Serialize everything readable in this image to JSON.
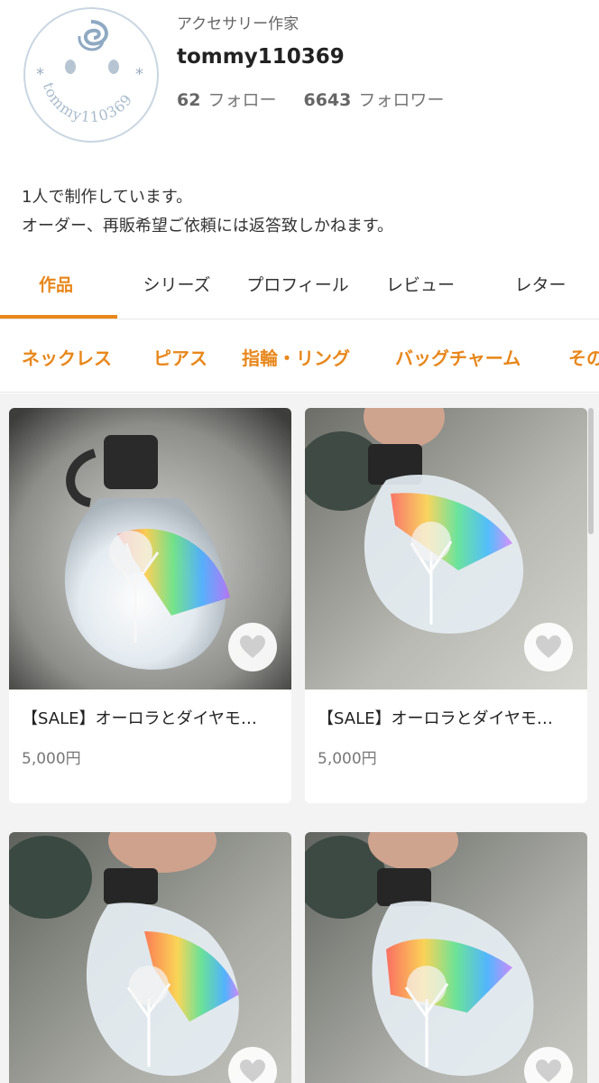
{
  "profile": {
    "avatar_text": "tommy110369",
    "category": "アクセサリー作家",
    "username": "tommy110369",
    "follow_count": "62",
    "follow_label": "フォロー",
    "follower_count": "6643",
    "follower_label": "フォロワー",
    "bio_line1": "1人で制作しています。",
    "bio_line2": "オーダー、再販希望ご依頼には返答致しかねます。"
  },
  "tabs": [
    {
      "label": "作品",
      "active": true
    },
    {
      "label": "シリーズ"
    },
    {
      "label": "プロフィール"
    },
    {
      "label": "レビュー"
    },
    {
      "label": "レター"
    }
  ],
  "categories": [
    "ネックレス",
    "ピアス",
    "指輪・リング",
    "バッグチャーム",
    "その"
  ],
  "products": [
    {
      "title": "【SALE】オーロラとダイヤモ…",
      "price": "5,000円",
      "favorite_icon": "heart-icon"
    },
    {
      "title": "【SALE】オーロラとダイヤモ…",
      "price": "5,000円",
      "favorite_icon": "heart-icon"
    },
    {
      "title": "",
      "price": "",
      "favorite_icon": "heart-icon"
    },
    {
      "title": "",
      "price": "",
      "favorite_icon": "heart-icon"
    }
  ],
  "colors": {
    "accent": "#e8871b",
    "grid_background": "#f3f3f3",
    "avatar_outline": "#c9d6e2"
  }
}
